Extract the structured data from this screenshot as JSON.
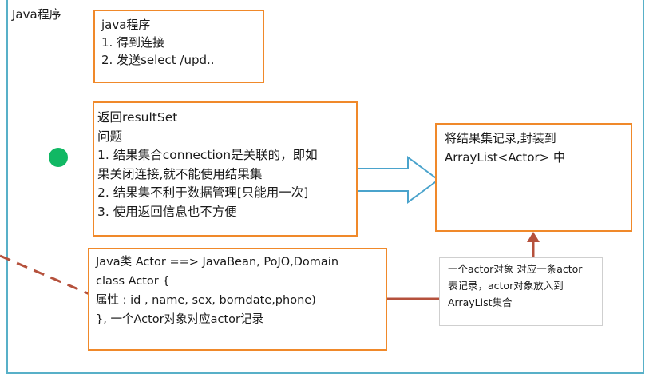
{
  "frame": {
    "title": "Java程序"
  },
  "box1": {
    "lines": [
      "java程序",
      "1. 得到连接",
      "2. 发送select /upd.."
    ]
  },
  "box2": {
    "lines": [
      "返回resultSet",
      "问题",
      "1. 结果集合connection是关联的，即如",
      "果关闭连接,就不能使用结果集",
      "2. 结果集不利于数据管理[只能用一次]",
      "3. 使用返回信息也不方便"
    ]
  },
  "box3": {
    "lines": [
      "将结果集记录,封装到",
      "ArrayList<Actor> 中"
    ]
  },
  "box4": {
    "lines": [
      "Java类 Actor  ==> JavaBean, PoJO,Domain",
      "class Actor {",
      "属性 : id , name, sex, borndate,phone)",
      "}, 一个Actor对象对应actor记录"
    ]
  },
  "box5": {
    "lines": [
      "一个actor对象 对应一条actor",
      "表记录，actor对象放入到",
      "ArrayList集合"
    ]
  },
  "colors": {
    "box_border": "#f0892a",
    "frame_border": "#58b0c8",
    "arrow_outline": "#4aa3cc",
    "connector": "#b5513c",
    "dot": "#11b864"
  }
}
